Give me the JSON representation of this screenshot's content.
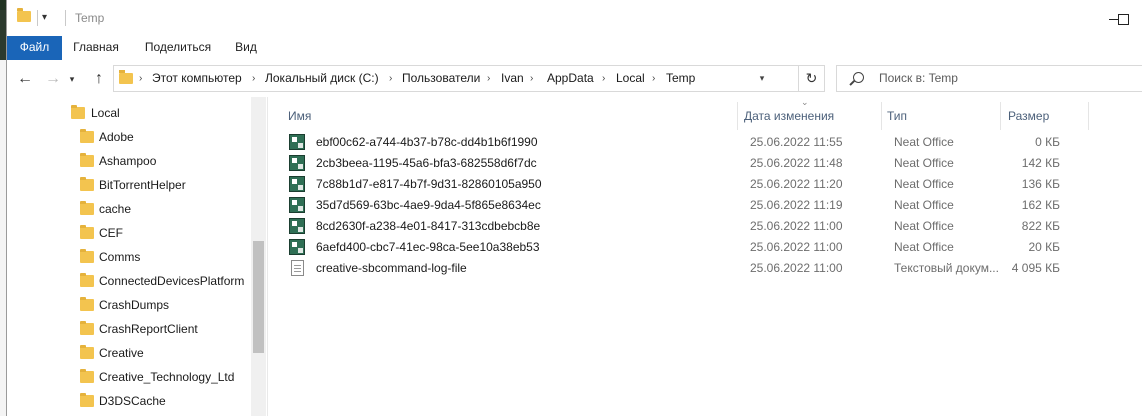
{
  "window": {
    "title": "Temp"
  },
  "ribbon": {
    "tabs": [
      {
        "label": "Файл",
        "active": true
      },
      {
        "label": "Главная"
      },
      {
        "label": "Поделиться"
      },
      {
        "label": "Вид"
      }
    ]
  },
  "address": {
    "crumbs": [
      "Этот компьютер",
      "Локальный диск (C:)",
      "Пользователи",
      "Ivan",
      "AppData",
      "Local",
      "Temp"
    ],
    "separator": "›"
  },
  "search": {
    "placeholder": "Поиск в: Temp"
  },
  "nav": {
    "items": [
      {
        "label": "Local",
        "level": 0
      },
      {
        "label": "Adobe",
        "level": 1
      },
      {
        "label": "Ashampoo",
        "level": 1
      },
      {
        "label": "BitTorrentHelper",
        "level": 1
      },
      {
        "label": "cache",
        "level": 1
      },
      {
        "label": "CEF",
        "level": 1
      },
      {
        "label": "Comms",
        "level": 1
      },
      {
        "label": "ConnectedDevicesPlatform",
        "level": 1
      },
      {
        "label": "CrashDumps",
        "level": 1
      },
      {
        "label": "CrashReportClient",
        "level": 1
      },
      {
        "label": "Creative",
        "level": 1
      },
      {
        "label": "Creative_Technology_Ltd",
        "level": 1
      },
      {
        "label": "D3DSCache",
        "level": 1
      }
    ]
  },
  "columns": {
    "name": "Имя",
    "date": "Дата изменения",
    "type": "Тип",
    "size": "Размер"
  },
  "files": [
    {
      "name": "ebf00c62-a744-4b37-b78c-dd4b1b6f1990",
      "date": "25.06.2022 11:55",
      "type": "Neat Office",
      "size": "0 КБ",
      "icon": "neat-office-icon"
    },
    {
      "name": "2cb3beea-1195-45a6-bfa3-682558d6f7dc",
      "date": "25.06.2022 11:48",
      "type": "Neat Office",
      "size": "142 КБ",
      "icon": "neat-office-icon"
    },
    {
      "name": "7c88b1d7-e817-4b7f-9d31-82860105a950",
      "date": "25.06.2022 11:20",
      "type": "Neat Office",
      "size": "136 КБ",
      "icon": "neat-office-icon"
    },
    {
      "name": "35d7d569-63bc-4ae9-9da4-5f865e8634ec",
      "date": "25.06.2022 11:19",
      "type": "Neat Office",
      "size": "162 КБ",
      "icon": "neat-office-icon"
    },
    {
      "name": "8cd2630f-a238-4e01-8417-313cdbebcb8e",
      "date": "25.06.2022 11:00",
      "type": "Neat Office",
      "size": "822 КБ",
      "icon": "neat-office-icon"
    },
    {
      "name": "6aefd400-cbc7-41ec-98ca-5ee10a38eb53",
      "date": "25.06.2022 11:00",
      "type": "Neat Office",
      "size": "20 КБ",
      "icon": "neat-office-icon"
    },
    {
      "name": "creative-sbcommand-log-file",
      "date": "25.06.2022 11:00",
      "type": "Текстовый докум...",
      "size": "4 095 КБ",
      "icon": "text-document-icon"
    }
  ],
  "colors": {
    "accent": "#1a65b8",
    "folder": "#f3c44f",
    "header_text": "#4c607a"
  },
  "icons": [
    "folder-icon",
    "back-arrow-icon",
    "forward-arrow-icon",
    "recent-chevron-icon",
    "up-arrow-icon",
    "refresh-icon",
    "search-icon",
    "minimize-icon",
    "maximize-icon"
  ]
}
